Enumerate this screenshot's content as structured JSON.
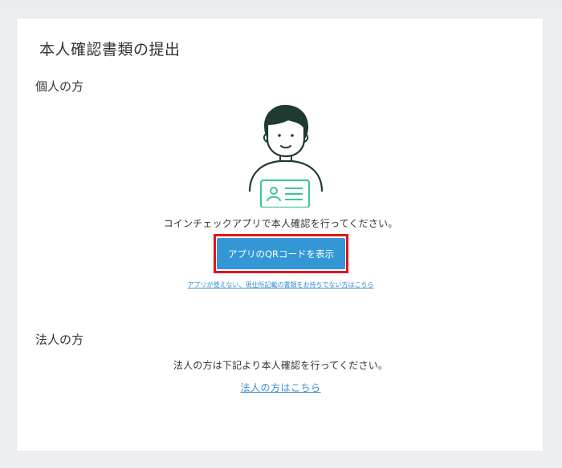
{
  "page": {
    "title": "本人確認書類の提出"
  },
  "individual": {
    "heading": "個人の方",
    "instruction": "コインチェックアプリで本人確認を行ってください。",
    "qr_button_label": "アプリのQRコードを表示",
    "alt_link": "アプリが使えない、現住所記載の書類をお持ちでない方はこちら",
    "illustration_icon": "person-with-id-card-icon"
  },
  "corporate": {
    "heading": "法人の方",
    "instruction": "法人の方は下記より本人確認を行ってください。",
    "link": "法人の方はこちら"
  },
  "colors": {
    "accent": "#3397d6",
    "link": "#3a8dd0",
    "highlight": "#e0141e",
    "illustration_stroke": "#1f3a33",
    "card_green": "#3cc79a"
  }
}
